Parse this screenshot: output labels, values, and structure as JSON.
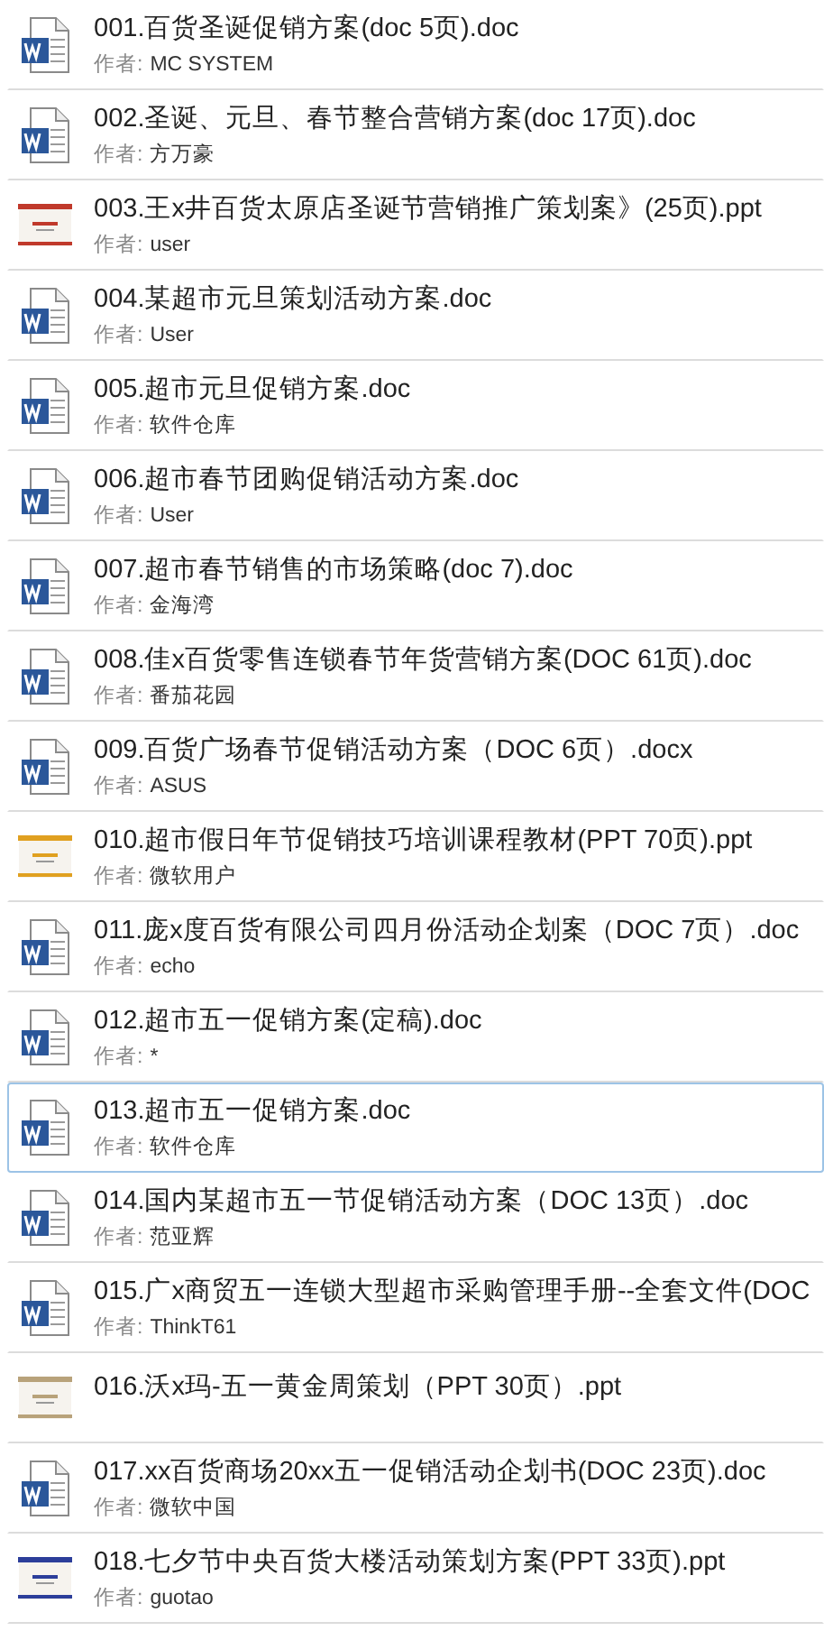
{
  "documents": [
    {
      "kind": "word",
      "title": "001.百货圣诞促销方案(doc 5页).doc",
      "author_label": "作者:",
      "author": "MC SYSTEM",
      "selected": false
    },
    {
      "kind": "word",
      "title": "002.圣诞、元旦、春节整合营销方案(doc 17页).doc",
      "author_label": "作者:",
      "author": "方万豪",
      "selected": false
    },
    {
      "kind": "slide",
      "color": "#c0392b",
      "title": "003.王x井百货太原店圣诞节营销推广策划案》(25页).ppt",
      "author_label": "作者:",
      "author": "user",
      "selected": false
    },
    {
      "kind": "word",
      "title": "004.某超市元旦策划活动方案.doc",
      "author_label": "作者:",
      "author": "User",
      "selected": false
    },
    {
      "kind": "word",
      "title": "005.超市元旦促销方案.doc",
      "author_label": "作者:",
      "author": "软件仓库",
      "selected": false
    },
    {
      "kind": "word",
      "title": "006.超市春节团购促销活动方案.doc",
      "author_label": "作者:",
      "author": "User",
      "selected": false
    },
    {
      "kind": "word",
      "title": "007.超市春节销售的市场策略(doc 7).doc",
      "author_label": "作者:",
      "author": "金海湾",
      "selected": false
    },
    {
      "kind": "word",
      "title": "008.佳x百货零售连锁春节年货营销方案(DOC 61页).doc",
      "author_label": "作者:",
      "author": "番茄花园",
      "selected": false
    },
    {
      "kind": "word",
      "title": "009.百货广场春节促销活动方案（DOC 6页）.docx",
      "author_label": "作者:",
      "author": "ASUS",
      "selected": false
    },
    {
      "kind": "slide",
      "color": "#e0a020",
      "title": "010.超市假日年节促销技巧培训课程教材(PPT 70页).ppt",
      "author_label": "作者:",
      "author": "微软用户",
      "selected": false
    },
    {
      "kind": "word",
      "title": "011.庞x度百货有限公司四月份活动企划案（DOC 7页）.doc",
      "author_label": "作者:",
      "author": "echo",
      "selected": false
    },
    {
      "kind": "word",
      "title": "012.超市五一促销方案(定稿).doc",
      "author_label": "作者:",
      "author": "*",
      "selected": false
    },
    {
      "kind": "word",
      "title": "013.超市五一促销方案.doc",
      "author_label": "作者:",
      "author": "软件仓库",
      "selected": true
    },
    {
      "kind": "word",
      "title": "014.国内某超市五一节促销活动方案（DOC 13页）.doc",
      "author_label": "作者:",
      "author": "范亚辉",
      "selected": false
    },
    {
      "kind": "word",
      "title": "015.广x商贸五一连锁大型超市采购管理手册--全套文件(DOC",
      "author_label": "作者:",
      "author": "ThinkT61",
      "selected": false
    },
    {
      "kind": "slide",
      "color": "#b8a27a",
      "title": "016.沃x玛-五一黄金周策划（PPT 30页）.ppt",
      "selected": false
    },
    {
      "kind": "word",
      "title": "017.xx百货商场20xx五一促销活动企划书(DOC 23页).doc",
      "author_label": "作者:",
      "author": "微软中国",
      "selected": false
    },
    {
      "kind": "slide",
      "color": "#2c3e9a",
      "title": "018.七夕节中央百货大楼活动策划方案(PPT 33页).ppt",
      "author_label": "作者:",
      "author": "guotao",
      "selected": false
    }
  ]
}
